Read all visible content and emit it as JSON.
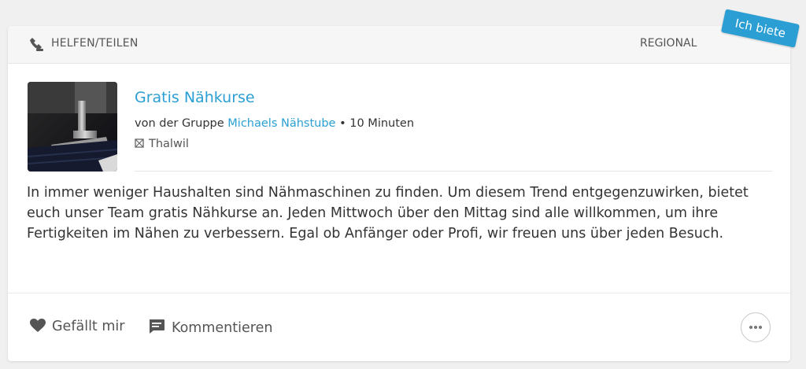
{
  "post": {
    "category": "HELFEN/TEILEN",
    "category_icon": "helping-hands-icon",
    "region": "REGIONAL",
    "badge": "Ich biete",
    "accent_color": "#2b9fd4",
    "title": "Gratis Nähkurse",
    "meta_prefix": "von der Gruppe",
    "group": "Michaels Nähstube",
    "meta_separator": "•",
    "time": "10 Minuten",
    "location": "Thalwil",
    "body": "In immer weniger Haushalten sind Nähmaschinen zu finden. Um diesem Trend entgegenzuwirken, bietet euch unser Team gratis Nähkurse an. Jeden Mittwoch über den Mittag sind alle willkommen, um ihre Fertigkeiten im Nähen zu verbessern. Egal ob Anfänger oder Profi, wir freuen uns über jeden Besuch."
  },
  "actions": {
    "like_label": "Gefällt mir",
    "comment_label": "Kommentieren",
    "more_icon": "ellipsis-icon"
  }
}
